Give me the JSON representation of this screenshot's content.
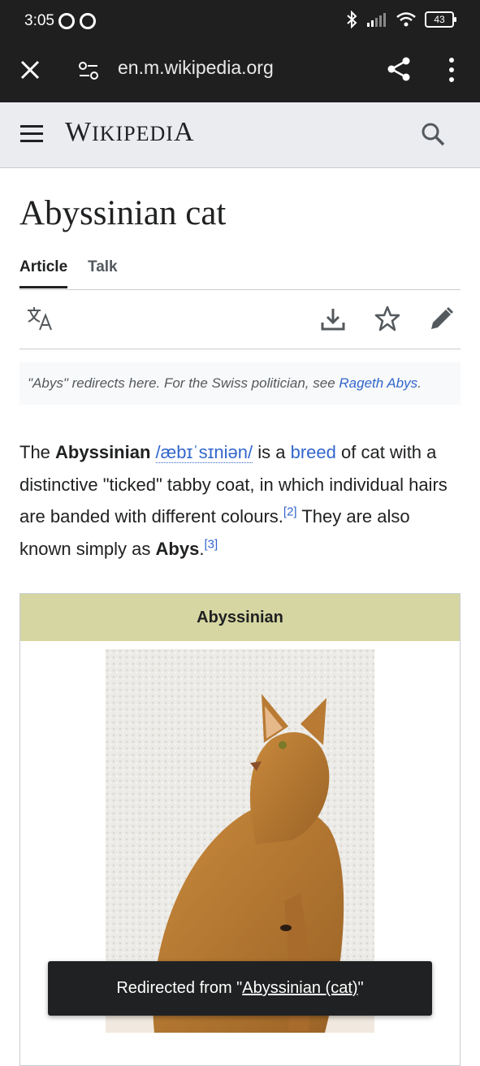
{
  "status_bar": {
    "time": "3:05",
    "battery": "43"
  },
  "browser": {
    "url": "en.m.wikipedia.org"
  },
  "wiki": {
    "logo_first": "W",
    "logo_mid": "IKIPEDI",
    "logo_last": "A"
  },
  "article": {
    "title": "Abyssinian cat",
    "tabs": [
      "Article",
      "Talk"
    ],
    "hatnote": {
      "prefix": "\"Abys\" redirects here. For the Swiss politician, see ",
      "link": "Rageth Abys",
      "suffix": "."
    },
    "lead": {
      "t1": "The ",
      "b1": "Abyssinian",
      "t2": " ",
      "ipa": "/æbɪˈsɪniən/",
      "t3": " is a ",
      "link_breed": "breed",
      "t4": " of cat with a distinctive \"ticked\" tabby coat, in which individual hairs are banded with different colours.",
      "ref1": "[2]",
      "t5": " They are also known simply as ",
      "b2": "Abys",
      "t6": ".",
      "ref2": "[3]"
    },
    "infobox_title": "Abyssinian"
  },
  "toast": {
    "prefix": "Redirected from \"",
    "link": "Abyssinian (cat)",
    "suffix": "\""
  },
  "colors": {
    "link": "#3366cc",
    "infobox_header": "#d6d6a3",
    "toolbar": "#1f1f1f"
  }
}
